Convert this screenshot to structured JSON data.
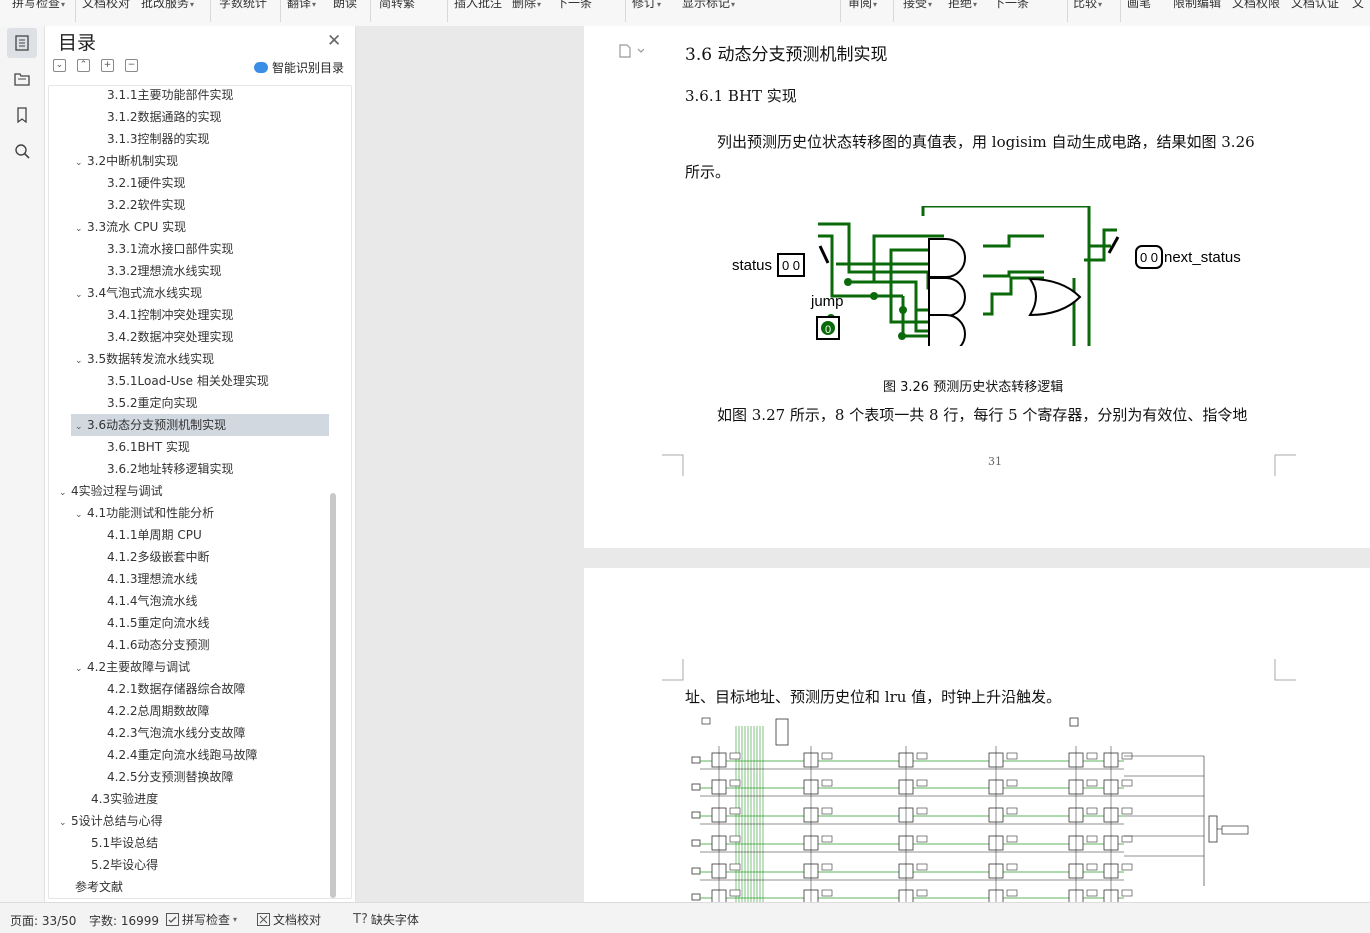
{
  "toolbar": {
    "items": [
      {
        "label": "拼写检查",
        "dd": "▾"
      },
      {
        "label": "文档校对",
        "dd": ""
      },
      {
        "label": "批改服务",
        "dd": "▾"
      },
      {
        "label": "字数统计",
        "dd": ""
      },
      {
        "label": "翻译",
        "dd": "▾"
      },
      {
        "label": "朗读",
        "dd": ""
      },
      {
        "label": "简转繁",
        "dd": ""
      },
      {
        "label": "插入批注",
        "dd": ""
      },
      {
        "label": "删除",
        "dd": "▾"
      },
      {
        "label": "下一条",
        "dd": ""
      },
      {
        "label": "修订",
        "dd": "▾"
      },
      {
        "label": "显示标记",
        "dd": "▾"
      },
      {
        "label": "审阅",
        "dd": "▾"
      },
      {
        "label": "接受",
        "dd": "▾"
      },
      {
        "label": "拒绝",
        "dd": "▾"
      },
      {
        "label": "下一条",
        "dd": ""
      },
      {
        "label": "比较",
        "dd": "▾"
      },
      {
        "label": "画笔",
        "dd": ""
      },
      {
        "label": "限制编辑",
        "dd": ""
      },
      {
        "label": "文档权限",
        "dd": ""
      },
      {
        "label": "文档认证",
        "dd": ""
      },
      {
        "label": "文",
        "dd": ""
      }
    ]
  },
  "toc": {
    "title": "目录",
    "smart_label": "智能识别目录",
    "items": [
      {
        "label": "3.1.1主要功能部件实现",
        "chev": ""
      },
      {
        "label": "3.1.2数据通路的实现",
        "chev": ""
      },
      {
        "label": "3.1.3控制器的实现",
        "chev": ""
      },
      {
        "label": "3.2中断机制实现",
        "chev": "⌄"
      },
      {
        "label": "3.2.1硬件实现",
        "chev": ""
      },
      {
        "label": "3.2.2软件实现",
        "chev": ""
      },
      {
        "label": "3.3流水 CPU 实现",
        "chev": "⌄"
      },
      {
        "label": "3.3.1流水接口部件实现",
        "chev": ""
      },
      {
        "label": "3.3.2理想流水线实现",
        "chev": ""
      },
      {
        "label": "3.4气泡式流水线实现",
        "chev": "⌄"
      },
      {
        "label": "3.4.1控制冲突处理实现",
        "chev": ""
      },
      {
        "label": "3.4.2数据冲突处理实现",
        "chev": ""
      },
      {
        "label": "3.5数据转发流水线实现",
        "chev": "⌄"
      },
      {
        "label": "3.5.1Load-Use 相关处理实现",
        "chev": ""
      },
      {
        "label": "3.5.2重定向实现",
        "chev": ""
      },
      {
        "label": "3.6动态分支预测机制实现",
        "chev": "⌄"
      },
      {
        "label": "3.6.1BHT 实现",
        "chev": ""
      },
      {
        "label": "3.6.2地址转移逻辑实现",
        "chev": ""
      },
      {
        "label": "4实验过程与调试",
        "chev": "⌄"
      },
      {
        "label": "4.1功能测试和性能分析",
        "chev": "⌄"
      },
      {
        "label": "4.1.1单周期 CPU",
        "chev": ""
      },
      {
        "label": "4.1.2多级嵌套中断",
        "chev": ""
      },
      {
        "label": "4.1.3理想流水线",
        "chev": ""
      },
      {
        "label": "4.1.4气泡流水线",
        "chev": ""
      },
      {
        "label": "4.1.5重定向流水线",
        "chev": ""
      },
      {
        "label": "4.1.6动态分支预测",
        "chev": ""
      },
      {
        "label": "4.2主要故障与调试",
        "chev": "⌄"
      },
      {
        "label": "4.2.1数据存储器综合故障",
        "chev": ""
      },
      {
        "label": "4.2.2总周期数故障",
        "chev": ""
      },
      {
        "label": "4.2.3气泡流水线分支故障",
        "chev": ""
      },
      {
        "label": "4.2.4重定向流水线跑马故障",
        "chev": ""
      },
      {
        "label": "4.2.5分支预测替换故障",
        "chev": ""
      },
      {
        "label": "4.3实验进度",
        "chev": ""
      },
      {
        "label": "5设计总结与心得",
        "chev": "⌄"
      },
      {
        "label": "5.1毕设总结",
        "chev": ""
      },
      {
        "label": "5.2毕设心得",
        "chev": ""
      },
      {
        "label": "参考文献",
        "chev": ""
      }
    ]
  },
  "document": {
    "page1": {
      "heading": "3.6   动态分支预测机制实现",
      "subheading": "3.6.1    BHT 实现",
      "para1_line1": "列出预测历史位状态转移图的真值表，用 logisim 自动生成电路，结果如图  3.26",
      "para1_line2": "所示。",
      "circuit": {
        "status_label": "status",
        "status_value": "0 0",
        "jump_label": "jump",
        "jump_value": "0",
        "output_label": "next_status",
        "output_value": "0 0"
      },
      "caption": "图  3.26  预测历史状态转移逻辑",
      "para2": "如图  3.27 所示，8 个表项一共 8 行，每行 5 个寄存器，分别为有效位、指令地",
      "page_number": "31"
    },
    "page2": {
      "para": "址、目标地址、预测历史位和 lru 值，时钟上升沿触发。"
    }
  },
  "statusbar": {
    "page": "页面: 33/50",
    "words": "字数: 16999",
    "spell": "拼写检查",
    "proof": "文档校对",
    "fonts": "缺失字体"
  },
  "colors": {
    "wire": "#0a6a0a",
    "accent": "#3a8ee6",
    "toc_selected": "#d1d8e0"
  }
}
